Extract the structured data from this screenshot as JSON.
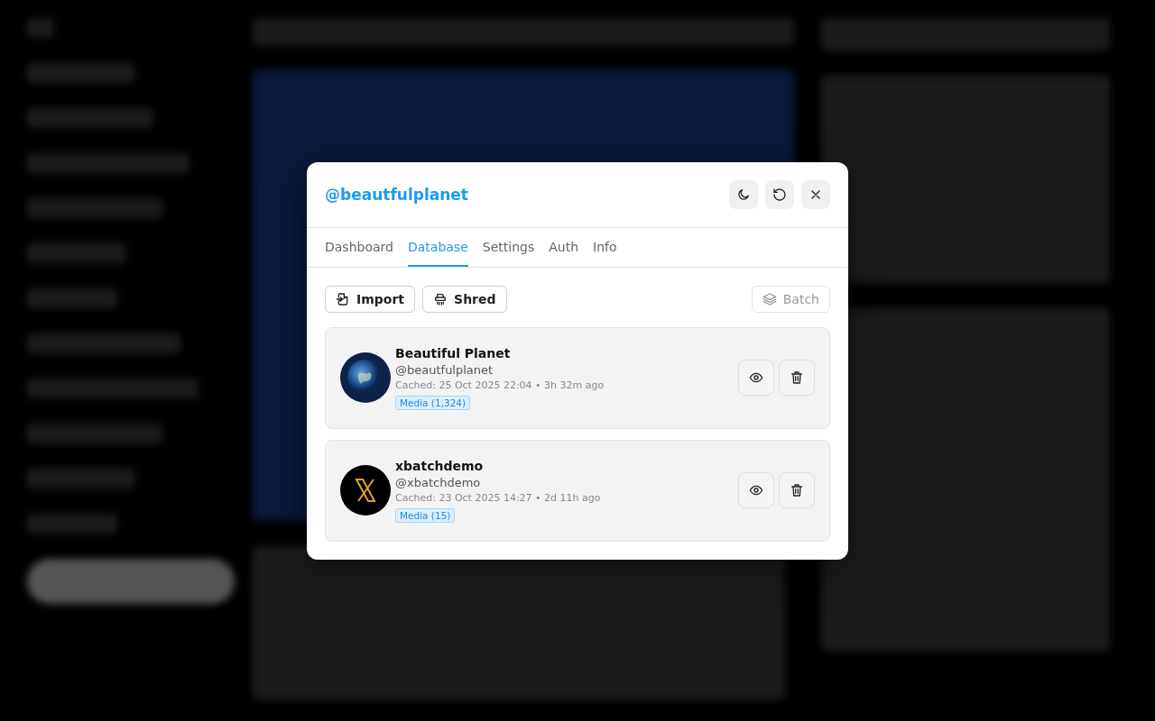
{
  "dialog": {
    "title": "@beautfulplanet",
    "tabs": [
      {
        "label": "Dashboard",
        "selected": false
      },
      {
        "label": "Database",
        "selected": true
      },
      {
        "label": "Settings",
        "selected": false
      },
      {
        "label": "Auth",
        "selected": false
      },
      {
        "label": "Info",
        "selected": false
      }
    ],
    "toolbar": [
      {
        "kind": "import",
        "label": "Import",
        "disabled": false
      },
      {
        "kind": "shred",
        "label": "Shred",
        "disabled": false
      },
      {
        "kind": "batch",
        "label": "Batch",
        "disabled": true
      }
    ],
    "accounts": [
      {
        "kind": "earth",
        "name": "Beautiful Planet",
        "handle": "@beautfulplanet",
        "cached": "Cached: 25 Oct 2025 22:04 • 3h 32m ago",
        "badge": "Media (1,324)"
      },
      {
        "kind": "x-logo",
        "name": "xbatchdemo",
        "handle": "@xbatchdemo",
        "cached": "Cached: 23 Oct 2025 14:27 • 2d 11h ago",
        "badge": "Media (15)"
      }
    ]
  }
}
